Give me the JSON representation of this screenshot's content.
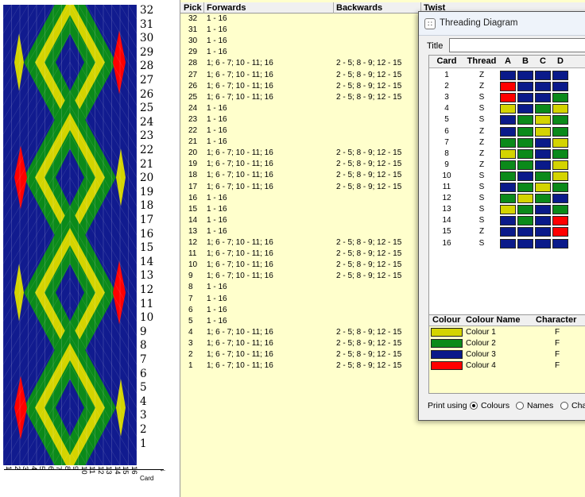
{
  "weave": {
    "row_numbers": [
      "32",
      "31",
      "30",
      "29",
      "28",
      "27",
      "26",
      "25",
      "24",
      "23",
      "22",
      "21",
      "20",
      "19",
      "18",
      "17",
      "16",
      "15",
      "14",
      "13",
      "12",
      "11",
      "10",
      "9",
      "8",
      "7",
      "6",
      "5",
      "4",
      "3",
      "2",
      "1"
    ],
    "card_numbers": [
      "1",
      "2",
      "3",
      "4",
      "5",
      "6",
      "7",
      "8",
      "9",
      "10",
      "11",
      "12",
      "13",
      "14",
      "15",
      "16"
    ],
    "card_axis_label": "Card",
    "colors": {
      "navy": "#111b8f",
      "green": "#0b8a1a",
      "yellow": "#d4d400",
      "red": "#ff0000"
    }
  },
  "pick_table": {
    "headers": {
      "pick": "Pick",
      "forwards": "Forwards",
      "backwards": "Backwards",
      "twist": "Twist"
    },
    "rows": [
      {
        "pick": "32",
        "forwards": "1 - 16",
        "backwards": ""
      },
      {
        "pick": "31",
        "forwards": "1 - 16",
        "backwards": ""
      },
      {
        "pick": "30",
        "forwards": "1 - 16",
        "backwards": ""
      },
      {
        "pick": "29",
        "forwards": "1 - 16",
        "backwards": ""
      },
      {
        "pick": "28",
        "forwards": "1; 6 - 7; 10 - 11; 16",
        "backwards": "2 - 5; 8 - 9; 12 - 15"
      },
      {
        "pick": "27",
        "forwards": "1; 6 - 7; 10 - 11; 16",
        "backwards": "2 - 5; 8 - 9; 12 - 15"
      },
      {
        "pick": "26",
        "forwards": "1; 6 - 7; 10 - 11; 16",
        "backwards": "2 - 5; 8 - 9; 12 - 15"
      },
      {
        "pick": "25",
        "forwards": "1; 6 - 7; 10 - 11; 16",
        "backwards": "2 - 5; 8 - 9; 12 - 15"
      },
      {
        "pick": "24",
        "forwards": "1 - 16",
        "backwards": ""
      },
      {
        "pick": "23",
        "forwards": "1 - 16",
        "backwards": ""
      },
      {
        "pick": "22",
        "forwards": "1 - 16",
        "backwards": ""
      },
      {
        "pick": "21",
        "forwards": "1 - 16",
        "backwards": ""
      },
      {
        "pick": "20",
        "forwards": "1; 6 - 7; 10 - 11; 16",
        "backwards": "2 - 5; 8 - 9; 12 - 15"
      },
      {
        "pick": "19",
        "forwards": "1; 6 - 7; 10 - 11; 16",
        "backwards": "2 - 5; 8 - 9; 12 - 15"
      },
      {
        "pick": "18",
        "forwards": "1; 6 - 7; 10 - 11; 16",
        "backwards": "2 - 5; 8 - 9; 12 - 15"
      },
      {
        "pick": "17",
        "forwards": "1; 6 - 7; 10 - 11; 16",
        "backwards": "2 - 5; 8 - 9; 12 - 15"
      },
      {
        "pick": "16",
        "forwards": "1 - 16",
        "backwards": ""
      },
      {
        "pick": "15",
        "forwards": "1 - 16",
        "backwards": ""
      },
      {
        "pick": "14",
        "forwards": "1 - 16",
        "backwards": ""
      },
      {
        "pick": "13",
        "forwards": "1 - 16",
        "backwards": ""
      },
      {
        "pick": "12",
        "forwards": "1; 6 - 7; 10 - 11; 16",
        "backwards": "2 - 5; 8 - 9; 12 - 15"
      },
      {
        "pick": "11",
        "forwards": "1; 6 - 7; 10 - 11; 16",
        "backwards": "2 - 5; 8 - 9; 12 - 15"
      },
      {
        "pick": "10",
        "forwards": "1; 6 - 7; 10 - 11; 16",
        "backwards": "2 - 5; 8 - 9; 12 - 15"
      },
      {
        "pick": "9",
        "forwards": "1; 6 - 7; 10 - 11; 16",
        "backwards": "2 - 5; 8 - 9; 12 - 15"
      },
      {
        "pick": "8",
        "forwards": "1 - 16",
        "backwards": ""
      },
      {
        "pick": "7",
        "forwards": "1 - 16",
        "backwards": ""
      },
      {
        "pick": "6",
        "forwards": "1 - 16",
        "backwards": ""
      },
      {
        "pick": "5",
        "forwards": "1 - 16",
        "backwards": ""
      },
      {
        "pick": "4",
        "forwards": "1; 6 - 7; 10 - 11; 16",
        "backwards": "2 - 5; 8 - 9; 12 - 15"
      },
      {
        "pick": "3",
        "forwards": "1; 6 - 7; 10 - 11; 16",
        "backwards": "2 - 5; 8 - 9; 12 - 15"
      },
      {
        "pick": "2",
        "forwards": "1; 6 - 7; 10 - 11; 16",
        "backwards": "2 - 5; 8 - 9; 12 - 15"
      },
      {
        "pick": "1",
        "forwards": "1; 6 - 7; 10 - 11; 16",
        "backwards": "2 - 5; 8 - 9; 12 - 15"
      }
    ]
  },
  "threading_window": {
    "title": "Threading Diagram",
    "title_label": "Title",
    "title_value": "",
    "headers": {
      "card": "Card",
      "thread": "Thread",
      "a": "A",
      "b": "B",
      "c": "C",
      "d": "D"
    },
    "cards": [
      {
        "card": "1",
        "thread": "Z",
        "holes": [
          "navy",
          "navy",
          "navy",
          "navy"
        ]
      },
      {
        "card": "2",
        "thread": "Z",
        "holes": [
          "red",
          "navy",
          "navy",
          "navy"
        ]
      },
      {
        "card": "3",
        "thread": "S",
        "holes": [
          "red",
          "navy",
          "navy",
          "green"
        ]
      },
      {
        "card": "4",
        "thread": "S",
        "holes": [
          "yellow",
          "navy",
          "green",
          "yellow"
        ]
      },
      {
        "card": "5",
        "thread": "S",
        "holes": [
          "navy",
          "green",
          "yellow",
          "green"
        ]
      },
      {
        "card": "6",
        "thread": "Z",
        "holes": [
          "navy",
          "green",
          "yellow",
          "green"
        ]
      },
      {
        "card": "7",
        "thread": "Z",
        "holes": [
          "green",
          "green",
          "navy",
          "yellow"
        ]
      },
      {
        "card": "8",
        "thread": "Z",
        "holes": [
          "yellow",
          "green",
          "navy",
          "green"
        ]
      },
      {
        "card": "9",
        "thread": "Z",
        "holes": [
          "green",
          "green",
          "navy",
          "yellow"
        ]
      },
      {
        "card": "10",
        "thread": "S",
        "holes": [
          "green",
          "navy",
          "green",
          "yellow"
        ]
      },
      {
        "card": "11",
        "thread": "S",
        "holes": [
          "navy",
          "green",
          "yellow",
          "green"
        ]
      },
      {
        "card": "12",
        "thread": "S",
        "holes": [
          "green",
          "yellow",
          "green",
          "navy"
        ]
      },
      {
        "card": "13",
        "thread": "S",
        "holes": [
          "yellow",
          "green",
          "navy",
          "green"
        ]
      },
      {
        "card": "14",
        "thread": "S",
        "holes": [
          "navy",
          "green",
          "navy",
          "red"
        ]
      },
      {
        "card": "15",
        "thread": "Z",
        "holes": [
          "navy",
          "navy",
          "navy",
          "red"
        ]
      },
      {
        "card": "16",
        "thread": "S",
        "holes": [
          "navy",
          "navy",
          "navy",
          "navy"
        ]
      }
    ],
    "colour_headers": {
      "colour": "Colour",
      "name": "Colour Name",
      "character": "Character"
    },
    "colours": [
      {
        "swatch": "yellow",
        "name": "Colour 1",
        "character": "F"
      },
      {
        "swatch": "green",
        "name": "Colour 2",
        "character": "F"
      },
      {
        "swatch": "navy",
        "name": "Colour 3",
        "character": "F"
      },
      {
        "swatch": "red",
        "name": "Colour 4",
        "character": "F"
      }
    ],
    "print_using": {
      "label": "Print using",
      "options": [
        "Colours",
        "Names",
        "Cha"
      ],
      "selected": "Colours"
    },
    "palette": {
      "navy": "#0a1a8a",
      "green": "#0b8a1a",
      "yellow": "#d4d400",
      "red": "#ff0000"
    }
  }
}
